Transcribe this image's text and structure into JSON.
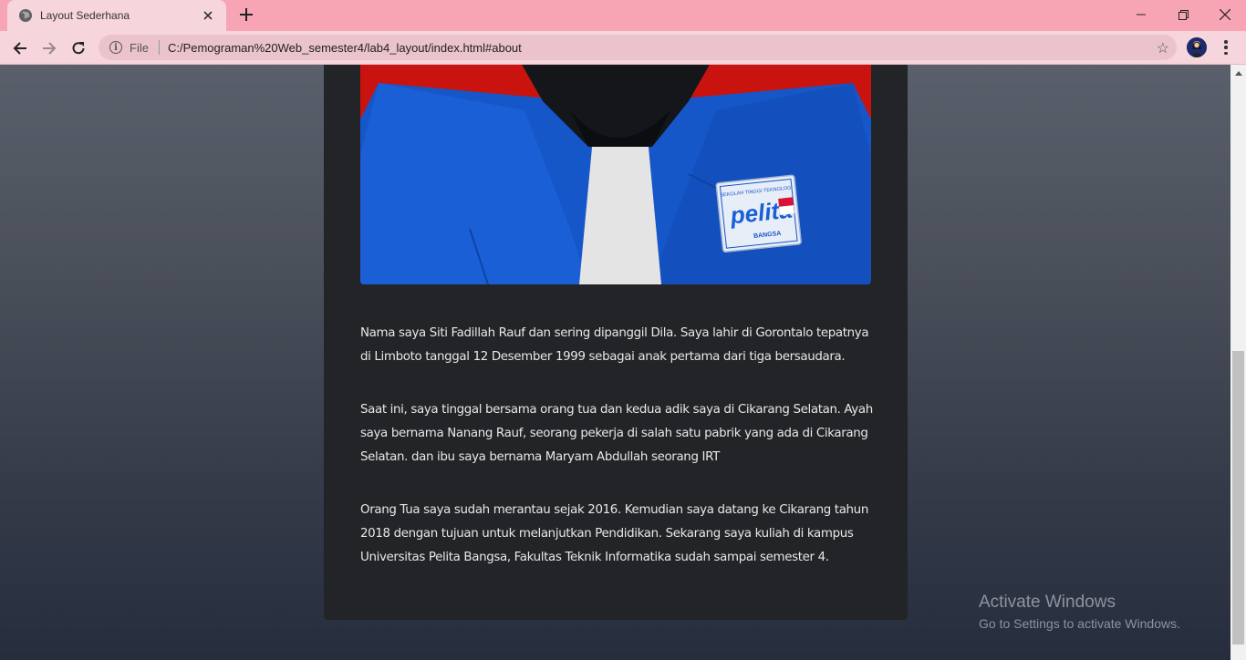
{
  "browser": {
    "tab_title": "Layout Sederhana",
    "address_scheme": "File",
    "address_url": "C:/Pemograman%20Web_semester4/lab4_layout/index.html#about",
    "icons": [
      "globe-icon",
      "close-icon",
      "plus-icon",
      "minimize-icon",
      "restore-icon",
      "close-window-icon",
      "back-arrow-icon",
      "forward-arrow-icon",
      "reload-icon",
      "info-icon",
      "star-icon",
      "profile-avatar",
      "menu-icon"
    ]
  },
  "about": {
    "paragraphs": [
      "Nama saya Siti Fadillah Rauf dan sering dipanggil Dila. Saya lahir di Gorontalo tepatnya di Limboto tanggal 12 Desember 1999 sebagai anak pertama dari tiga bersaudara.",
      "Saat ini, saya tinggal bersama orang tua dan kedua adik saya di Cikarang Selatan. Ayah saya bernama Nanang Rauf, seorang pekerja di salah satu pabrik yang ada di Cikarang Selatan. dan ibu saya bernama Maryam Abdullah seorang IRT",
      "Orang Tua saya sudah merantau sejak 2016. Kemudian saya datang ke Cikarang tahun 2018 dengan tujuan untuk melanjutkan Pendidikan. Sekarang saya kuliah di kampus Universitas Pelita Bangsa, Fakultas Teknik Informatika sudah sampai semester 4."
    ],
    "photo": {
      "badge_top": "SEKOLAH TINGGI TEKNOLOGI",
      "badge_main": "pelita",
      "badge_sub": "BANGSA",
      "colors": {
        "background": "#c8130f",
        "jacket": "#1557c9",
        "scarf": "#15161a",
        "shirt": "#e4e4e4"
      }
    }
  },
  "overlay": {
    "activate_title": "Activate Windows",
    "activate_sub": "Go to Settings to activate Windows."
  },
  "colors": {
    "tab_strip": "#f7a5b5",
    "toolbar": "#f7d5dc",
    "card": "#222427",
    "text": "#e8e8e8"
  }
}
